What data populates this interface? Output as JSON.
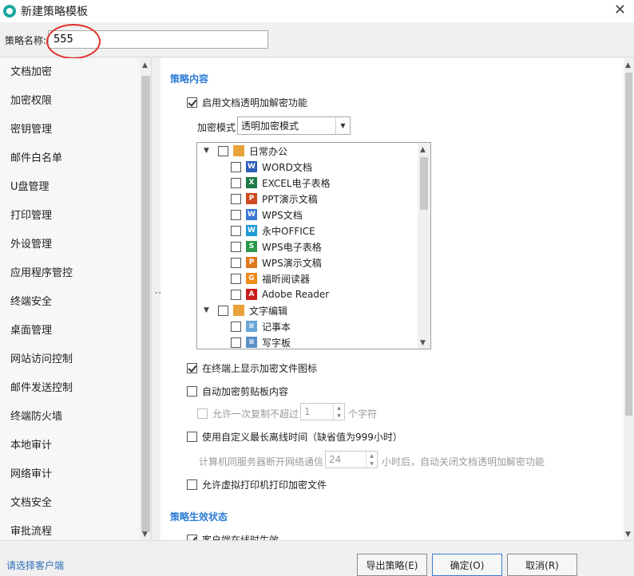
{
  "window": {
    "title": "新建策略模板",
    "close_label": "✕"
  },
  "policy_name": {
    "label": "策略名称:",
    "value": "555"
  },
  "sidebar": {
    "items": [
      {
        "label": "文档加密"
      },
      {
        "label": "加密权限"
      },
      {
        "label": "密钥管理"
      },
      {
        "label": "邮件白名单"
      },
      {
        "label": "U盘管理"
      },
      {
        "label": "打印管理"
      },
      {
        "label": "外设管理"
      },
      {
        "label": "应用程序管控"
      },
      {
        "label": "终端安全"
      },
      {
        "label": "桌面管理"
      },
      {
        "label": "网站访问控制"
      },
      {
        "label": "邮件发送控制"
      },
      {
        "label": "终端防火墙"
      },
      {
        "label": "本地审计"
      },
      {
        "label": "网络审计"
      },
      {
        "label": "文档安全"
      },
      {
        "label": "审批流程"
      }
    ]
  },
  "content": {
    "section1_title": "策略内容",
    "enable_transparent": {
      "label": "启用文档透明加解密功能",
      "checked": true
    },
    "encrypt_mode": {
      "label": "加密模式",
      "value": "透明加密模式"
    },
    "tree": {
      "groups": [
        {
          "label": "日常办公",
          "items": [
            {
              "label": "WORD文档",
              "icon": "word-icon",
              "color": "#2b5fb8",
              "glyph": "W"
            },
            {
              "label": "EXCEL电子表格",
              "icon": "excel-icon",
              "color": "#1e7a44",
              "glyph": "X"
            },
            {
              "label": "PPT演示文稿",
              "icon": "ppt-icon",
              "color": "#d04a1f",
              "glyph": "P"
            },
            {
              "label": "WPS文档",
              "icon": "wps-writer-icon",
              "color": "#3a78d6",
              "glyph": "W"
            },
            {
              "label": "永中OFFICE",
              "icon": "yozo-icon",
              "color": "#1f9ad6",
              "glyph": "W"
            },
            {
              "label": "WPS电子表格",
              "icon": "wps-sheet-icon",
              "color": "#2a9a4a",
              "glyph": "S"
            },
            {
              "label": "WPS演示文稿",
              "icon": "wps-ppt-icon",
              "color": "#e0781f",
              "glyph": "P"
            },
            {
              "label": "福昕阅读器",
              "icon": "foxit-icon",
              "color": "#f08a1a",
              "glyph": "G"
            },
            {
              "label": "Adobe Reader",
              "icon": "adobe-reader-icon",
              "color": "#c81e1e",
              "glyph": "A"
            }
          ]
        },
        {
          "label": "文字编辑",
          "items": [
            {
              "label": "记事本",
              "icon": "notepad-icon",
              "color": "#6aa6d8",
              "glyph": "≡"
            },
            {
              "label": "写字板",
              "icon": "wordpad-icon",
              "color": "#5b8fc8",
              "glyph": "≡"
            }
          ]
        }
      ]
    },
    "show_icon": {
      "label": "在终端上显示加密文件图标",
      "checked": true
    },
    "auto_clipboard": {
      "label": "自动加密剪贴板内容",
      "checked": false
    },
    "copy_limit": {
      "label_before": "允许一次复制不超过",
      "value": "1",
      "label_after": "个字符"
    },
    "custom_offline": {
      "label": "使用自定义最长离线时间（缺省值为999小时）",
      "checked": false
    },
    "offline_detail": {
      "label_before": "计算机同服务器断开网络通信",
      "value": "24",
      "label_after": "小时后，自动关闭文档透明加解密功能"
    },
    "virtual_printer": {
      "label": "允许虚拟打印机打印加密文件",
      "checked": false
    },
    "section2_title": "策略生效状态",
    "client_online": {
      "label": "客户端在线时生效",
      "checked": true
    }
  },
  "footer": {
    "select_client_link": "请选择客户端",
    "export_button": "导出策略(E)",
    "ok_button": "确定(O)",
    "cancel_button": "取消(R)"
  }
}
